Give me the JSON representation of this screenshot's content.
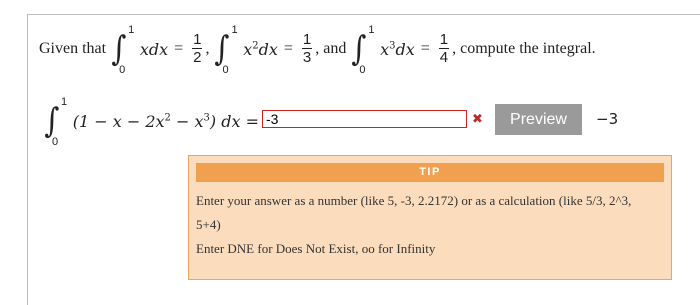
{
  "problem": {
    "given_that": "Given that",
    "int1_integrand": "xdx",
    "int1_result_num": "1",
    "int1_result_den": "2",
    "int2_integrand": "x",
    "int2_exp": "2",
    "int2_dx": "dx",
    "int2_result_num": "1",
    "int2_result_den": "3",
    "and": ", and",
    "int3_integrand": "x",
    "int3_exp": "3",
    "int3_dx": "dx",
    "int3_result_num": "1",
    "int3_result_den": "4",
    "compute": ", compute the integral.",
    "lower_limit": "0",
    "upper_limit": "1"
  },
  "question": {
    "integrand": "(1 − x − 2x",
    "exp2": "2",
    "minus_x": " − x",
    "exp3": "3",
    "close": ") dx =",
    "lower_limit": "0",
    "upper_limit": "1"
  },
  "answer": {
    "value": "-3",
    "error_icon": "✖",
    "preview_label": "Preview",
    "preview_value": "−3"
  },
  "tip": {
    "title": "TIP",
    "line1": "Enter your answer as a number (like 5, -3, 2.2172) or as a calculation (like 5/3, 2^3,",
    "line2": "5+4)",
    "line3": "Enter DNE for Does Not Exist, oo for Infinity"
  },
  "colors": {
    "error_border": "#cc2222",
    "tip_background": "#fbdcbd",
    "tip_header": "#f0a04f",
    "preview_button": "#9a9a9a"
  }
}
